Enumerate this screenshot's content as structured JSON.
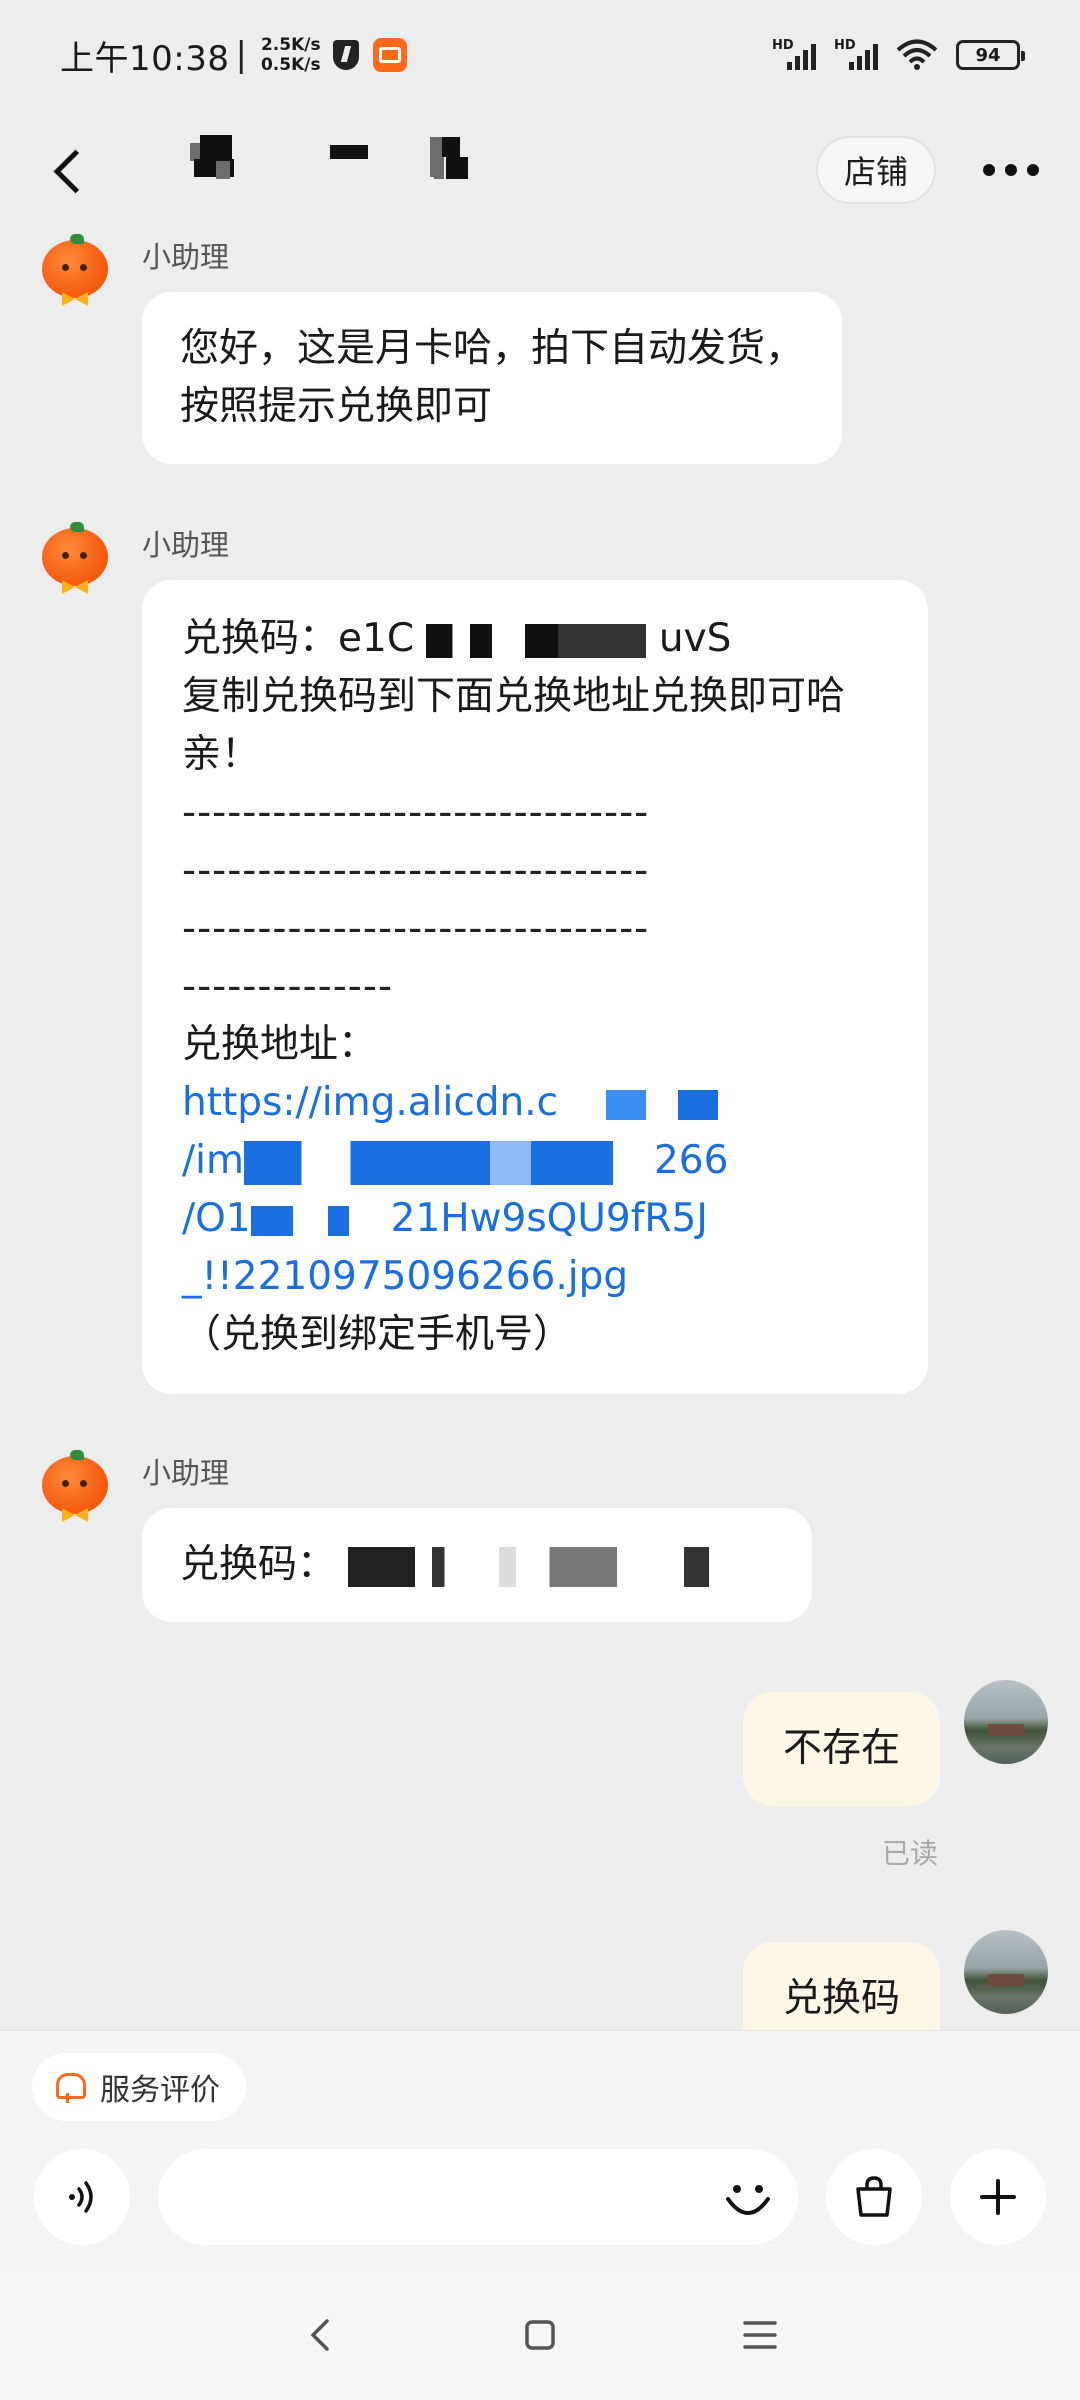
{
  "status_bar": {
    "time": "上午10:38",
    "separator": "|",
    "net_up": "2.5K/s",
    "net_down": "0.5K/s",
    "signal_1": "HD",
    "signal_2": "HD",
    "battery": "94",
    "icons": [
      "shield-icon",
      "app-notification-icon",
      "signal-icon",
      "wifi-icon",
      "battery-icon"
    ]
  },
  "header": {
    "shop_button": "店铺",
    "icons": [
      "back-icon",
      "more-icon"
    ]
  },
  "messages": [
    {
      "side": "in",
      "sender": "小助理",
      "text": "您好，这是月卡哈，拍下自动发货，按照提示兑换即可"
    },
    {
      "side": "in",
      "sender": "小助理",
      "code_label": "兑换码：",
      "code_visible_start": "e1C",
      "code_visible_end": "uvS",
      "instruction": "复制兑换码到下面兑换地址兑换即可哈亲！",
      "dash_lines": [
        "-------------------------------",
        "-------------------------------",
        "-------------------------------",
        "--------------"
      ],
      "address_label": "兑换地址：",
      "link_lines": [
        "https://img.alicdn.c",
        "/im",
        "266",
        "/O1",
        "21Hw9sQU9fR5J",
        "_!!2210975096266.jpg"
      ],
      "note": "（兑换到绑定手机号）"
    },
    {
      "side": "in",
      "sender": "小助理",
      "code_label": "兑换码："
    },
    {
      "side": "out",
      "text": "不存在",
      "status": "已读"
    },
    {
      "side": "out",
      "text": "兑换码"
    }
  ],
  "bottom": {
    "review_chip": "服务评价",
    "input_placeholder": "",
    "icons": [
      "voice-icon",
      "emoji-icon",
      "shopping-bag-icon",
      "plus-icon"
    ]
  },
  "nav": {
    "icons": [
      "nav-back-icon",
      "nav-home-icon",
      "nav-menu-icon"
    ]
  },
  "colors": {
    "background": "#ededed",
    "bubble_in": "#ffffff",
    "bubble_out": "#fdf7e8",
    "link": "#1a6fe0",
    "accent": "#ff6a1a"
  }
}
